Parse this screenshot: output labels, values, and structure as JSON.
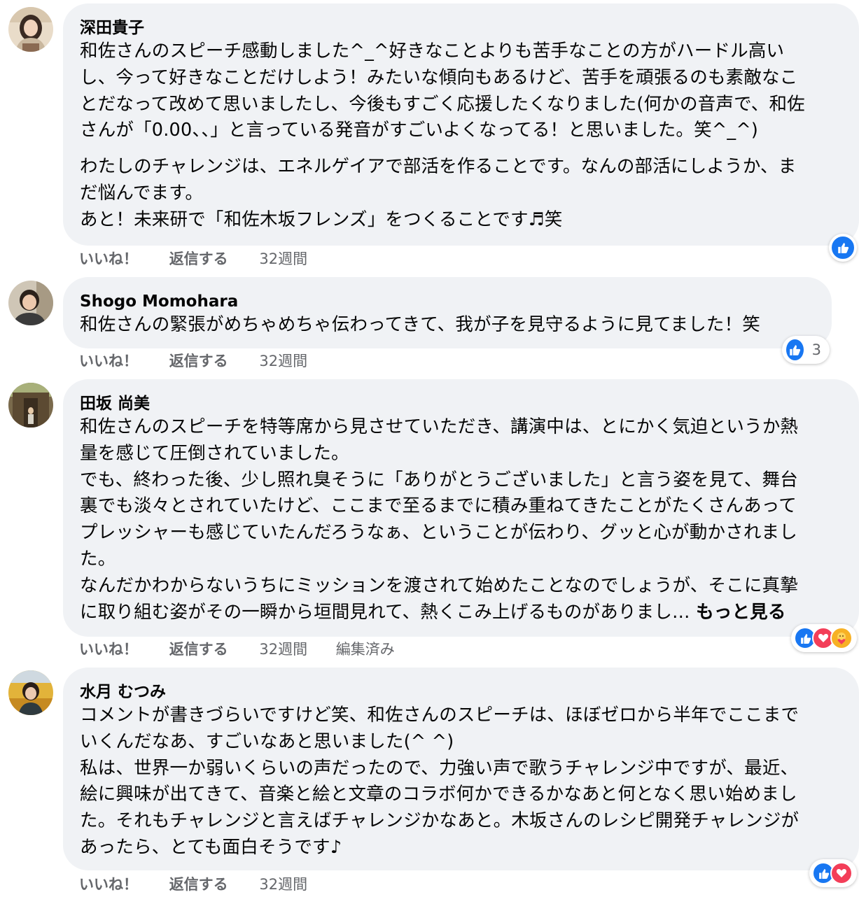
{
  "actions": {
    "like": "いいね！",
    "reply": "返信する"
  },
  "colors": {
    "bubble": "#f0f2f5",
    "like": "#1877f2",
    "love": "#f33e58",
    "care": "#f7b125",
    "meta_text": "#65676b"
  },
  "comments": [
    {
      "author": "深田貴子",
      "lines": [
        "和佐さんのスピーチ感動しました^_^好きなことよりも苦手なことの方がハードル高い",
        "し、今って好きなことだけしよう！みたいな傾向もあるけど、苦手を頑張るのも素敵なこ",
        "とだなって改めて思いましたし、今後もすごく応援したくなりました(何かの音声で、和佐",
        "さんが「0.00、、」と言っている発音がすごいよくなってる！と思いました。笑^_^)"
      ],
      "lines2": [
        "わたしのチャレンジは、エネルゲイアで部活を作ることです。なんの部活にしようか、ま",
        "だ悩んでます。",
        "あと！未来研で「和佐木坂フレンズ」をつくることです♬笑"
      ],
      "time": "32週間",
      "reactions": [
        "like-icon"
      ],
      "reaction_count": ""
    },
    {
      "author": "Shogo Momohara",
      "lines": [
        "和佐さんの緊張がめちゃめちゃ伝わってきて、我が子を見守るように見てました！笑"
      ],
      "time": "32週間",
      "reactions": [
        "like-icon"
      ],
      "reaction_count": "3"
    },
    {
      "author": "田坂 尚美",
      "lines": [
        "和佐さんのスピーチを特等席から見させていただき、講演中は、とにかく気迫というか熱",
        "量を感じて圧倒されていました。",
        "でも、終わった後、少し照れ臭そうに「ありがとうございました」と言う姿を見て、舞台",
        "裏でも淡々とされていたけど、ここまで至るまでに積み重ねてきたことがたくさんあって",
        "プレッシャーも感じていたんだろうなぁ、ということが伝わり、グッと心が動かされまし",
        "た。",
        "なんだかわからないうちにミッションを渡されて始めたことなのでしょうが、そこに真摯",
        "に取り組む姿がその一瞬から垣間見れて、熱くこみ上げるものがありまし…"
      ],
      "see_more": "もっと見る",
      "time": "32週間",
      "edited": "編集済み",
      "reactions": [
        "like-icon",
        "love-icon",
        "care-icon"
      ],
      "reaction_count": ""
    },
    {
      "author": "水月 むつみ",
      "lines": [
        "コメントが書きづらいですけど笑、和佐さんのスピーチは、ほぼゼロから半年でここまで",
        "いくんだなあ、すごいなあと思いました(^ ^)",
        "私は、世界一か弱いくらいの声だったので、力強い声で歌うチャレンジ中ですが、最近、",
        "絵に興味が出てきて、音楽と絵と文章のコラボ何かできるかなあと何となく思い始めまし",
        "た。それもチャレンジと言えばチャレンジかなあと。木坂さんのレシピ開発チャレンジが",
        "あったら、とても面白そうです♪"
      ],
      "time": "32週間",
      "reactions": [
        "like-icon",
        "love-icon"
      ],
      "reaction_count": ""
    }
  ]
}
